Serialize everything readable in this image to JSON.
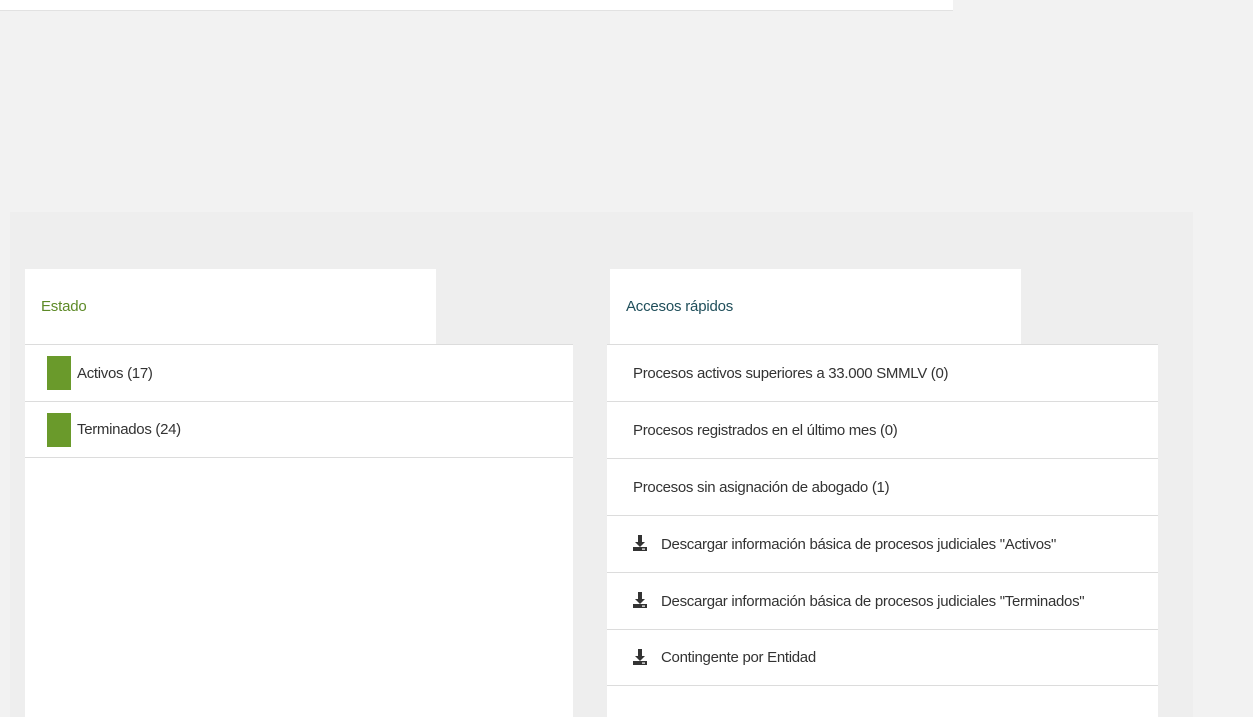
{
  "colors": {
    "estado_title": "#5d8a27",
    "accesos_title": "#1f4e5a",
    "activos_swatch": "#6a9a2b",
    "terminados_swatch": "#6a9a2b"
  },
  "estado": {
    "title": "Estado",
    "items": [
      {
        "label": "Activos (17)",
        "color": "#6a9a2b"
      },
      {
        "label": "Terminados (24)",
        "color": "#6a9a2b"
      }
    ]
  },
  "accesos": {
    "title": "Accesos rápidos",
    "links": [
      {
        "label": "Procesos activos superiores a 33.000 SMMLV (0)",
        "icon": null
      },
      {
        "label": "Procesos registrados en el último mes (0)",
        "icon": null
      },
      {
        "label": "Procesos sin asignación de abogado (1)",
        "icon": null
      },
      {
        "label": "Descargar información básica de procesos judiciales \"Activos\"",
        "icon": "download-icon"
      },
      {
        "label": "Descargar información básica de procesos judiciales \"Terminados\"",
        "icon": "download-icon"
      },
      {
        "label": "Contingente por Entidad",
        "icon": "download-icon"
      }
    ]
  }
}
